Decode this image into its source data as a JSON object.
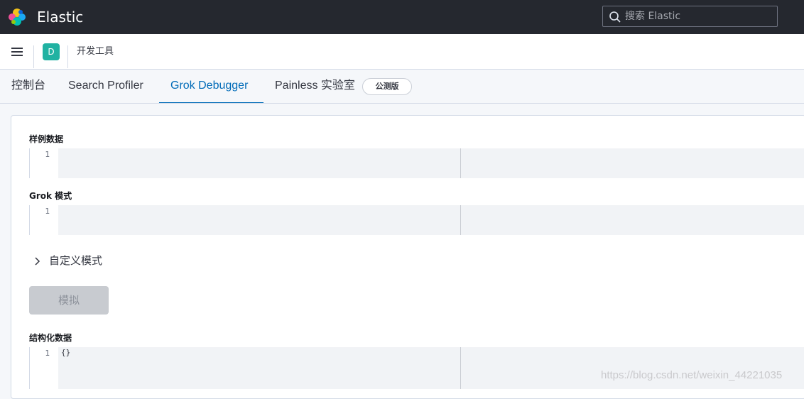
{
  "header": {
    "brand": "Elastic",
    "search_placeholder": "搜索 Elastic"
  },
  "subnav": {
    "space_initial": "D",
    "breadcrumb": "开发工具"
  },
  "tabs": [
    {
      "label": "控制台",
      "active": false
    },
    {
      "label": "Search Profiler",
      "active": false
    },
    {
      "label": "Grok Debugger",
      "active": true
    },
    {
      "label": "Painless 实验室",
      "active": false
    }
  ],
  "beta_badge": "公测版",
  "form": {
    "sample_label": "样例数据",
    "sample_line": "1",
    "pattern_label": "Grok 模式",
    "pattern_line": "1",
    "custom_patterns": "自定义模式",
    "simulate_button": "模拟",
    "structured_label": "结构化数据",
    "structured_line": "1",
    "structured_value": "{}"
  },
  "watermark": "https://blog.csdn.net/weixin_44221035",
  "colors": {
    "header_bg": "#25282f",
    "accent": "#006bb8",
    "space_badge": "#20b2a2"
  }
}
